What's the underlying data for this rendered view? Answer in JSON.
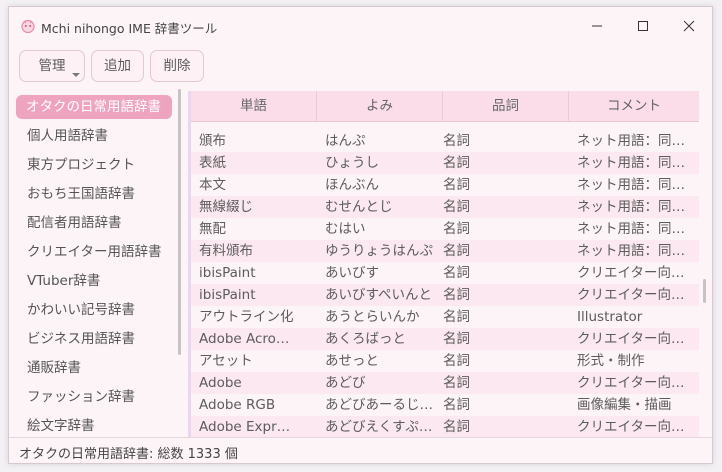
{
  "window": {
    "title": "Mchi nihongo IME 辞書ツール",
    "icon": "app-icon",
    "controls": {
      "minimize": "minimize-icon",
      "maximize": "maximize-icon",
      "close": "close-icon"
    }
  },
  "toolbar": {
    "manage_label": "管理",
    "add_label": "追加",
    "delete_label": "削除"
  },
  "sidebar": {
    "items": [
      {
        "label": "オタクの日常用語辞書",
        "selected": true
      },
      {
        "label": "個人用語辞書"
      },
      {
        "label": "東方プロジェクト"
      },
      {
        "label": "おもち王国語辞書"
      },
      {
        "label": "配信者用語辞書"
      },
      {
        "label": "クリエイター用語辞書"
      },
      {
        "label": "VTuber辞書"
      },
      {
        "label": "かわいい記号辞書"
      },
      {
        "label": "ビジネス用語辞書"
      },
      {
        "label": "通販辞書"
      },
      {
        "label": "ファッション辞書"
      },
      {
        "label": "絵文字辞書"
      }
    ]
  },
  "table": {
    "columns": [
      "単語",
      "よみ",
      "品詞",
      "コメント"
    ],
    "rows": [
      [
        "頒布",
        "はんぷ",
        "名詞",
        "ネット用語：同…"
      ],
      [
        "表紙",
        "ひょうし",
        "名詞",
        "ネット用語：同…"
      ],
      [
        "本文",
        "ほんぶん",
        "名詞",
        "ネット用語：同…"
      ],
      [
        "無線綴じ",
        "むせんとじ",
        "名詞",
        "ネット用語：同…"
      ],
      [
        "無配",
        "むはい",
        "名詞",
        "ネット用語：同…"
      ],
      [
        "有料頒布",
        "ゆうりょうはんぷ",
        "名詞",
        "ネット用語：同…"
      ],
      [
        "ibisPaint",
        "あいびす",
        "名詞",
        "クリエイター向…"
      ],
      [
        "ibisPaint",
        "あいびすぺいんと",
        "名詞",
        "クリエイター向…"
      ],
      [
        "アウトライン化",
        "あうとらいんか",
        "名詞",
        "Illustrator"
      ],
      [
        "Adobe Acro…",
        "あくろばっと",
        "名詞",
        "クリエイター向…"
      ],
      [
        "アセット",
        "あせっと",
        "名詞",
        "形式・制作"
      ],
      [
        "Adobe",
        "あどび",
        "名詞",
        "クリエイター向…"
      ],
      [
        "Adobe RGB",
        "あどびあーるじ…",
        "名詞",
        "画像編集・描画"
      ],
      [
        "Adobe Expr…",
        "あどびえくすぷ…",
        "名詞",
        "クリエイター向…"
      ]
    ]
  },
  "status": {
    "text": "オタクの日常用語辞書: 総数 1333 個"
  },
  "colors": {
    "window_bg": "#fdf4f8",
    "accent": "#eea3bf",
    "header_bg": "#fbdde9",
    "alt_row": "#fbe8f0"
  }
}
